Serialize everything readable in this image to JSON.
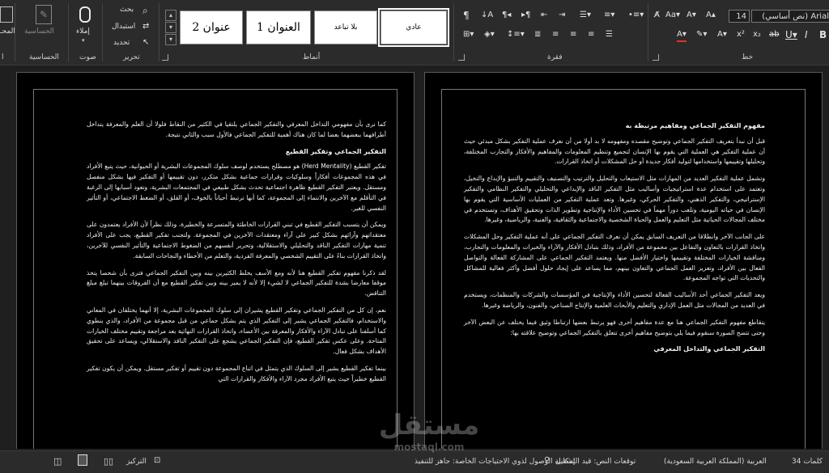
{
  "ribbon": {
    "groups": {
      "font": "خط",
      "paragraph": "فقرة",
      "styles": "أنماط",
      "editing": "تحرير",
      "voice": "صوت",
      "sensitivity": "الحساسية",
      "editor_partial": "ا"
    },
    "font_name": "Arial (نص أساسي)",
    "font_size": "14",
    "styles": {
      "normal": "عادي",
      "no_spacing": "بلا تباعد",
      "heading1": "العنوان 1",
      "heading2": "عنوان 2"
    },
    "editing": {
      "find": "بحث",
      "replace": "استبدال",
      "select": "تحديد"
    },
    "dictate": "إملاء",
    "sensitivity_btn": "الحساسية",
    "editor_btn": "المحـ"
  },
  "pages": {
    "right": {
      "heading1": "مفهوم التفكير الجماعي ومفاهيم مرتبطة به",
      "p1": "قبل أن نبدأ بتعريف التفكير الجماعي وتوضيح مقصده ومفهومه لا بد أولا من أن نعرف عملية التفكير بشكل مبدئي حيث أن عملية التفكير هي العملية التي يقوم بها الإنسان لتجميع وتنظيم المعلومات والمفاهيم والأفكار والتجارب المختلفة، وتحليلها وتقييمها واستخدامها لتوليد أفكار جديدة أو حل المشكلات أو اتخاذ القرارات.",
      "p2": "وتشمل عملية التفكير العديد من المهارات مثل الاستيعاب والتحليل والترتيب والتصنيف والتقييم والتنبؤ والإبداع والتخيل، وتعتمد على استخدام عدة استراتيجيات وأساليب مثل التفكير الناقد والإبداعي والتحليلي والتفكير النظامي والتفكير الإستراتيجي، والتفكير الذهني، والتفكير الحركي، وغيرها. وتعد عملية التفكير من العمليات الأساسية التي يقوم بها الإنسان في حياته اليومية، وتلعب دوراً مهماً في تحسين الأداء والإنتاجية وتطوير الذات وتحقيق الأهداف، وتستخدم في مختلف المجالات الحياتية مثل التعليم والعمل والحياة الشخصية والاجتماعية والثقافية، والفنية، والرياضية، وغيرها.",
      "p3": "على الجانب الآخر وانطلاقا من التعريف السابق يمكن أن نعرف التفكير الجماعي على أنه عملية التفكير وحل المشكلات واتخاذ القرارات بالتعاون والتفاعل بين مجموعة من الأفراد، وذلك بتبادل الأفكار والآراء والخبرات والمعلومات والتجارب، ومناقشة الخيارات المختلفة وتقييمها واختيار الأفضل منها. ويعتمد التفكير الجماعي على المشاركة الفعالة والتواصل الفعال بين الأفراد، وتعزيز العمل الجماعي والتعاون بينهم، مما يساعد على إيجاد حلول أفضل وأكثر فعالية للمشاكل والتحديات التي تواجه المجموعة.",
      "p4": "ويعد التفكير الجماعي أحد الأساليب الفعالة لتحسين الأداء والإنتاجية في المؤسسات والشركات والمنظمات، ويستخدم في العديد من المجالات مثل العمل الإداري والتعليم والأبحاث العلمية والإنتاج الصناعي، والفنون، والرياضة وغيرها.",
      "p5": "يتقاطع مفهوم التفكير الجماعي هنا مع عدة مفاهيم أخرى فهو يرتبط بعضها ارتباطا وثيق فيما يختلف عن البعض الآخر وحتى تتضح الصورة سنقوم فيما يلي بتوضيح مفاهيم أخرى تتعلق بالتفكير الجماعي وتوضيح علاقته بها:",
      "heading2": "التفكير الجماعي والتداخل المعرفي"
    },
    "left": {
      "p1": "كما نرى بأن مفهومي التداخل المعرفي والتفكير الجماعي يلتقيا في الكثير من النقاط فلولا أن العلم والمعرفة يتداخل أطرافهما ببعضهما بعضا لما كان هناك أهمية للتفكير الجماعي فالأول سبب والثاني نتيجة.",
      "heading1": "التفكير الجماعي وتفكير القطيع",
      "p2": "تفكير القطيع (Herd Mentality) هو مصطلح يستخدم لوصف سلوك المجموعات البشرية أو الحيوانية، حيث يتبع الأفراد في هذه المجموعات أفكاراً وسلوكيات وقرارات جماعية بشكل متكرر، دون تقييمها أو التفكير فيها بشكل منفصل ومستقل. ويعتبر التفكير القطيع ظاهرة اجتماعية تحدث بشكل طبيعي في المجتمعات البشرية، وتعود أسبابها إلى الرغبة في التأقلم مع الآخرين والانتماء إلى المجموعة، كما أنها ترتبط أحياناً بالخوف، أو القلق، أو الضغط الاجتماعي، أو التأثير النفسي للغير.",
      "p3": "ويمكن أن يتسبب التفكير القطيع في تبني القرارات الخاطئة والمتسرعة والخطيرة، وذلك نظراً لأن الأفراد يعتمدون على معتقداتهم وآرائهم بشكل كبير على آراء ومعتقدات الآخرين في المجموعة. ولتجنب تفكير القطيع، يجب على الأفراد تنمية مهارات التفكير الناقد والتحليلي والاستقلالية، وتحرير أنفسهم من الضغوط الاجتماعية والتأثير النفسي للآخرين، واتخاذ القرارات بناءً على التقييم الشخصي والمعرفة الفردية، والتعلم من الأخطاء والنجاحات السابقة.",
      "p4": "لقد ذكرنا مفهوم تفكير القطيع هنا لأنه ومع الأسف يخلط الكثيرين بينه وبين التفكير الجماعي فترى بأن شخصا يتخذ موقفا معارضا بشدة للتفكير الجماعي لا لشيء إلا لأنه لا يميز بينه وبين تفكير القطيع مع أن الفروقات بينهما تبلغ مبلغ التناقض.",
      "p5": "نعم، إن كل من التفكير الجماعي وتفكير القطيع يشيران إلى سلوك المجموعات البشرية، إلا أنهما يختلفان في المعاني والاستخدام، فالتفكير الجماعي يشير إلى التفكير الذي يتم بشكل جماعي من قبل مجموعة من الأفراد، والذي ينطوي كما أسلفنا على تبادل الآراء والأفكار والمعرفة بين الأعضاء، واتخاذ القرارات النهائية بعد مراجعة وتقييم مختلف الخيارات المتاحة. وعلى عكس تفكير القطيع، فإن التفكير الجماعي يشجع على التفكير الناقد والاستقلالي، ويساعد على تحقيق الأهداف بشكل فعال.",
      "p6": "بينما تفكير القطيع يشير إلى السلوك الذي يتمثل في اتباع المجموعة دون تقييم أو تفكير مستقل. ويمكن أن يكون تفكير القطيع خطيراً حيث يتبع الأفراد مجرد الآراء والأفكار والقرارات التي"
    }
  },
  "statusbar": {
    "words": "34 كلمات",
    "language": "العربية (المملكة العربية السعودية)",
    "predictions": "توقعات النص: قيد التشغيل",
    "accessibility": "إمكانية الوصول لذوي الاحتياجات الخاصة: جاهز للتنفيذ",
    "focus": "التركيز"
  },
  "watermark": {
    "text": "مستقل",
    "domain": "mostaql.com"
  }
}
